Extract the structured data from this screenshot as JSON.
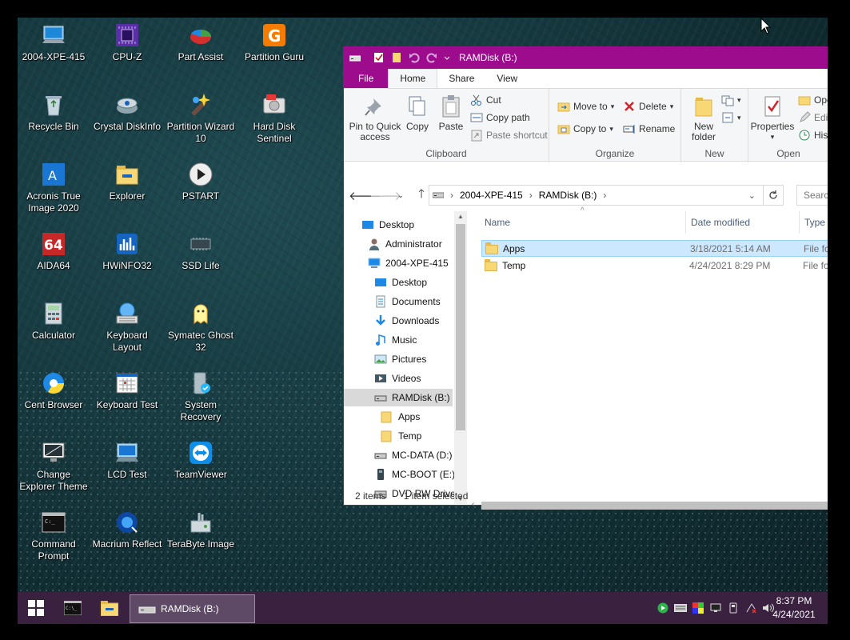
{
  "desktop": {
    "icons": [
      {
        "label": "2004-XPE-415",
        "icon": "computer-icon"
      },
      {
        "label": "CPU-Z",
        "icon": "cpu-z-icon"
      },
      {
        "label": "Part Assist",
        "icon": "part-assist-icon"
      },
      {
        "label": "Partition Guru",
        "icon": "partition-guru-icon"
      },
      {
        "label": "Recycle Bin",
        "icon": "recycle-bin-icon"
      },
      {
        "label": "Crystal DiskInfo",
        "icon": "crystal-diskinfo-icon"
      },
      {
        "label": "Partition Wizard 10",
        "icon": "partition-wizard-icon"
      },
      {
        "label": "Hard Disk Sentinel",
        "icon": "hard-disk-sentinel-icon"
      },
      {
        "label": "Acronis True Image 2020",
        "icon": "acronis-icon"
      },
      {
        "label": "Explorer",
        "icon": "explorer-icon"
      },
      {
        "label": "PSTART",
        "icon": "pstart-icon"
      },
      {
        "label": "AIDA64",
        "icon": "aida64-icon"
      },
      {
        "label": "HWiNFO32",
        "icon": "hwinfo-icon"
      },
      {
        "label": "SSD Life",
        "icon": "ssd-life-icon"
      },
      {
        "label": "Calculator",
        "icon": "calculator-icon"
      },
      {
        "label": "Keyboard Layout",
        "icon": "keyboard-layout-icon"
      },
      {
        "label": "Symatec Ghost 32",
        "icon": "ghost-icon"
      },
      {
        "label": "Cent Browser",
        "icon": "cent-browser-icon"
      },
      {
        "label": "Keyboard Test",
        "icon": "keyboard-test-icon"
      },
      {
        "label": "System Recovery",
        "icon": "system-recovery-icon"
      },
      {
        "label": "Change Explorer Theme",
        "icon": "change-theme-icon"
      },
      {
        "label": "LCD Test",
        "icon": "lcd-test-icon"
      },
      {
        "label": "TeamViewer",
        "icon": "teamviewer-icon"
      },
      {
        "label": "Command Prompt",
        "icon": "command-prompt-icon"
      },
      {
        "label": "Macrium Reflect",
        "icon": "macrium-icon"
      },
      {
        "label": "TeraByte Image",
        "icon": "terabyte-icon"
      }
    ]
  },
  "window": {
    "title": "RAMDisk (B:)",
    "accent": "#9c0c8c",
    "tabs": {
      "file": "File",
      "home": "Home",
      "share": "Share",
      "view": "View"
    },
    "ribbon": {
      "pin_label_1": "Pin to Quick",
      "pin_label_2": "access",
      "copy": "Copy",
      "paste": "Paste",
      "cut": "Cut",
      "copy_path": "Copy path",
      "paste_shortcut": "Paste shortcut",
      "clipboard": "Clipboard",
      "move_to": "Move to",
      "copy_to": "Copy to",
      "delete": "Delete",
      "rename": "Rename",
      "organize": "Organize",
      "new_folder_1": "New",
      "new_folder_2": "folder",
      "new": "New",
      "properties": "Properties",
      "open": "Ope",
      "edit": "Edit",
      "history": "Hist",
      "open_group": "Open"
    },
    "address": {
      "segments": [
        "2004-XPE-415",
        "RAMDisk (B:)"
      ],
      "search_placeholder": "Search"
    },
    "nav": [
      {
        "label": "Desktop",
        "indent": 0,
        "icon": "desktop-folder-icon"
      },
      {
        "label": "Administrator",
        "indent": 1,
        "icon": "user-icon"
      },
      {
        "label": "2004-XPE-415",
        "indent": 1,
        "icon": "computer-icon"
      },
      {
        "label": "Desktop",
        "indent": 2,
        "icon": "desktop-folder-icon"
      },
      {
        "label": "Documents",
        "indent": 2,
        "icon": "documents-icon"
      },
      {
        "label": "Downloads",
        "indent": 2,
        "icon": "downloads-icon"
      },
      {
        "label": "Music",
        "indent": 2,
        "icon": "music-icon"
      },
      {
        "label": "Pictures",
        "indent": 2,
        "icon": "pictures-icon"
      },
      {
        "label": "Videos",
        "indent": 2,
        "icon": "videos-icon"
      },
      {
        "label": "RAMDisk (B:)",
        "indent": 2,
        "icon": "drive-icon"
      },
      {
        "label": "Apps",
        "indent": 3,
        "icon": "folder-icon"
      },
      {
        "label": "Temp",
        "indent": 3,
        "icon": "folder-icon"
      },
      {
        "label": "MC-DATA (D:)",
        "indent": 2,
        "icon": "drive-icon"
      },
      {
        "label": "MC-BOOT (E:)",
        "indent": 2,
        "icon": "usb-drive-icon"
      },
      {
        "label": "DVD RW Drive",
        "indent": 2,
        "icon": "dvd-drive-icon"
      }
    ],
    "columns": {
      "name": "Name",
      "date": "Date modified",
      "type": "Type"
    },
    "files": [
      {
        "name": "Apps",
        "date": "3/18/2021 5:14 AM",
        "type": "File fo"
      },
      {
        "name": "Temp",
        "date": "4/24/2021 8:29 PM",
        "type": "File fo"
      }
    ],
    "status": {
      "items": "2 items",
      "selected": "1 item selected"
    }
  },
  "taskbar": {
    "active_window": "RAMDisk (B:)",
    "time": "8:37 PM",
    "date": "4/24/2021",
    "background": "#3a2140"
  }
}
